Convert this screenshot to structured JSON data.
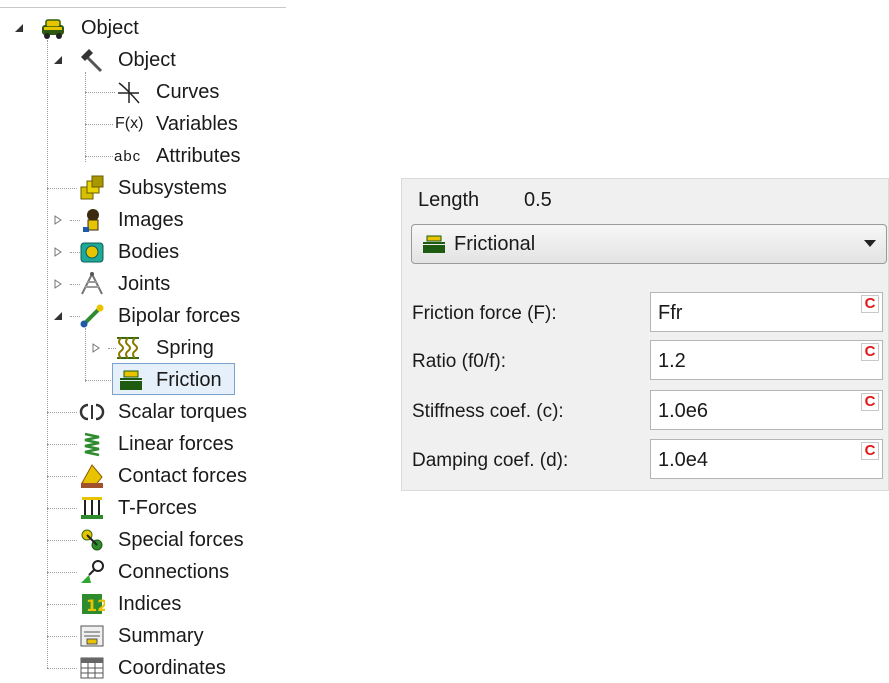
{
  "tree": {
    "root": "Object",
    "object": "Object",
    "curves": "Curves",
    "variables": "Variables",
    "variables_icon_text": "F(x)",
    "attributes": "Attributes",
    "attributes_icon_text": "abc",
    "subsystems": "Subsystems",
    "images": "Images",
    "bodies": "Bodies",
    "joints": "Joints",
    "bipolar_forces": "Bipolar forces",
    "spring": "Spring",
    "friction": "Friction",
    "scalar_torques": "Scalar torques",
    "linear_forces": "Linear forces",
    "contact_forces": "Contact forces",
    "t_forces": "T-Forces",
    "special_forces": "Special forces",
    "connections": "Connections",
    "indices": "Indices",
    "summary": "Summary",
    "coordinates": "Coordinates"
  },
  "panel": {
    "length_label": "Length",
    "length_value": "0.5",
    "type_selected": "Frictional",
    "c_label": "C",
    "rows": [
      {
        "label": "Friction force (F):",
        "value": "Ffr"
      },
      {
        "label": "Ratio (f0/f):",
        "value": "1.2"
      },
      {
        "label": "Stiffness coef. (c):",
        "value": "1.0e6"
      },
      {
        "label": "Damping coef. (d):",
        "value": "1.0e4"
      }
    ]
  },
  "colors": {
    "selection_border": "#7da2ce",
    "selection_fill": "#e6f0fb",
    "c_red": "#e01818",
    "icon_green": "#2e8b2e",
    "icon_yellow": "#e8c400"
  }
}
